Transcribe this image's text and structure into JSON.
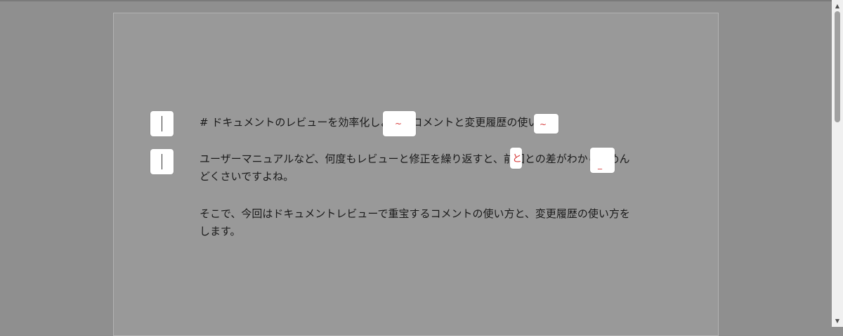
{
  "document": {
    "heading_line": "# ドキュメントのレビューを効率化しよう！コメントと変更履歴の使い方",
    "paragraph2": "ユーザーマニュアルなど、何度もレビューと修正を繰り返すと、前回との差がわからずめんどくさいですよね。",
    "paragraph3": "そこで、今回はドキュメントレビューで重宝するコメントの使い方と、変更履歴の使い方をします。"
  },
  "track_marks": {
    "mark1": "~",
    "mark2": "~",
    "mark3": "と",
    "mark4": "_"
  },
  "scrollbar": {
    "up_arrow": "▲",
    "down_arrow": "▼"
  },
  "colors": {
    "background": "#8f8f8f",
    "page": "#999999",
    "revision_red": "#d63a3a"
  }
}
